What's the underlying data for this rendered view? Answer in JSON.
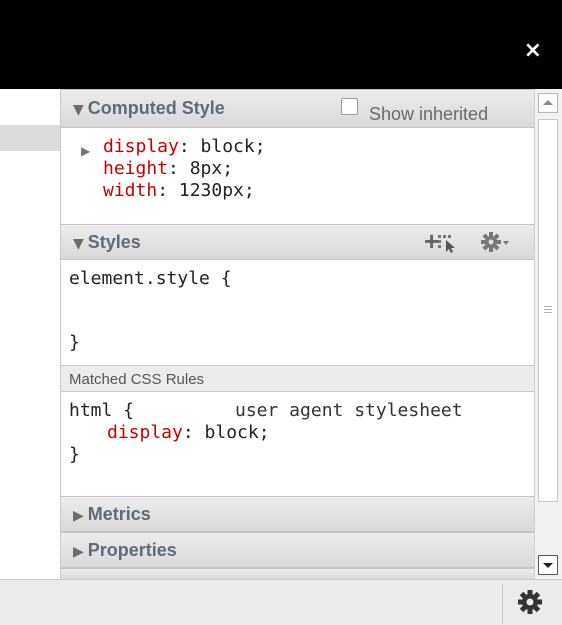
{
  "window": {
    "close_symbol": "×"
  },
  "computed": {
    "title": "Computed Style",
    "show_inherited": "Show inherited",
    "props": [
      {
        "name": "display",
        "value": "block"
      },
      {
        "name": "height",
        "value": "8px"
      },
      {
        "name": "width",
        "value": "1230px"
      }
    ]
  },
  "styles": {
    "title": "Styles",
    "add_symbol": "+",
    "element_selector": "element.style {",
    "element_close": "}"
  },
  "matched": {
    "label": "Matched CSS Rules",
    "rule_selector": "html {",
    "rule_source": "user agent stylesheet",
    "rule_prop": "display",
    "rule_value": "block",
    "rule_close": "}"
  },
  "sections": {
    "metrics": "Metrics",
    "properties": "Properties"
  },
  "colors": {
    "property_name": "#c80000",
    "header_text": "#5f6a7a"
  }
}
